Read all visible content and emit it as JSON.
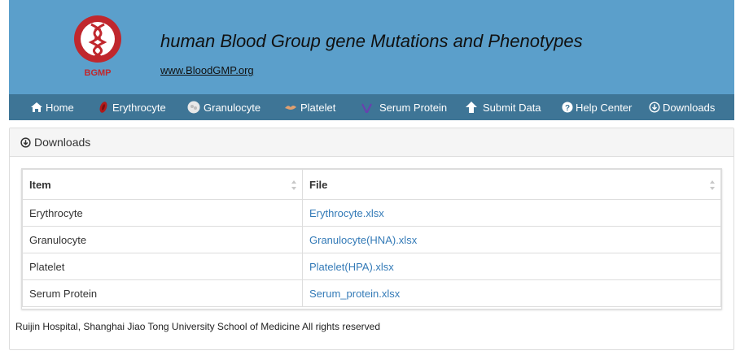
{
  "header": {
    "logo_text": "BGMP",
    "title": "human Blood Group gene Mutations and Phenotypes",
    "url": "www.BloodGMP.org"
  },
  "nav": {
    "items": [
      {
        "label": "Home",
        "icon": "home-icon"
      },
      {
        "label": "Erythrocyte",
        "icon": "erythrocyte-icon"
      },
      {
        "label": "Granulocyte",
        "icon": "granulocyte-icon"
      },
      {
        "label": "Platelet",
        "icon": "platelet-icon"
      },
      {
        "label": "Serum Protein",
        "icon": "serum-protein-icon"
      },
      {
        "label": "Submit Data",
        "icon": "upload-arrow-icon"
      },
      {
        "label": "Help Center",
        "icon": "question-circle-icon"
      },
      {
        "label": "Downloads",
        "icon": "download-circle-icon"
      }
    ]
  },
  "panel": {
    "title": "Downloads"
  },
  "table": {
    "headers": [
      "Item",
      "File"
    ],
    "rows": [
      {
        "item": "Erythrocyte",
        "file": "Erythrocyte.xlsx"
      },
      {
        "item": "Granulocyte",
        "file": "Granulocyte(HNA).xlsx"
      },
      {
        "item": "Platelet",
        "file": "Platelet(HPA).xlsx"
      },
      {
        "item": "Serum Protein",
        "file": "Serum_protein.xlsx"
      }
    ]
  },
  "footer": {
    "text": "Ruijin Hospital, Shanghai Jiao Tong University School of Medicine All rights reserved"
  },
  "colors": {
    "header_bg": "#5b9fcb",
    "nav_bg": "#3e7596",
    "link": "#337ab7",
    "logo_red": "#c0272d"
  }
}
